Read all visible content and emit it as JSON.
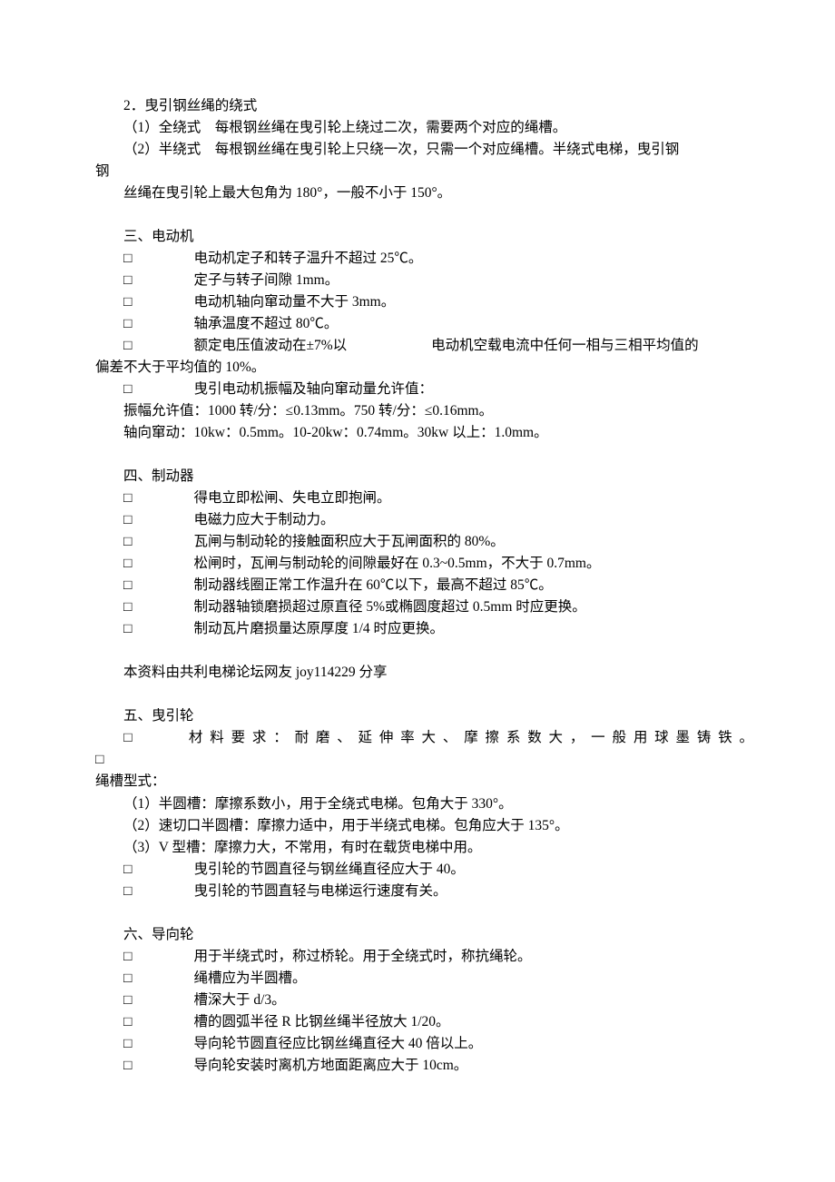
{
  "s2": {
    "title": "2．曳引钢丝绳的绕式",
    "p1": "（1）全绕式　每根钢丝绳在曳引轮上绕过二次，需要两个对应的绳槽。",
    "p2": "（2）半绕式　每根钢丝绳在曳引轮上只绕一次，只需一个对应绳槽。半绕式电梯，曳引钢",
    "p2b": "丝绳在曳引轮上最大包角为 180°，一般不小于 150°。"
  },
  "s3": {
    "title": "三、电动机",
    "b1": "电动机定子和转子温升不超过 25℃。",
    "b2": "定子与转子间隙 1mm。",
    "b3": "电动机轴向窜动量不大于 3mm。",
    "b4": "轴承温度不超过 80℃。",
    "b5a": "额定电压值波动在±7%以",
    "b5b": "电动机空载电流中任何一相与三相平均值的",
    "b5c": "偏差不大于平均值的 10%。",
    "b6": "曳引电动机振幅及轴向窜动量允许值：",
    "l1": "振幅允许值：1000 转/分：≤0.13mm。750 转/分：≤0.16mm。",
    "l2": "轴向窜动：10kw：0.5mm。10-20kw：0.74mm。30kw 以上：1.0mm。"
  },
  "s4": {
    "title": "四、制动器",
    "b1": "得电立即松闸、失电立即抱闸。",
    "b2": "电磁力应大于制动力。",
    "b3": "瓦闸与制动轮的接触面积应大于瓦闸面积的 80%。",
    "b4": "松闸时，瓦闸与制动轮的间隙最好在 0.3~0.5mm，不大于 0.7mm。",
    "b5": "制动器线圈正常工作温升在 60℃以下，最高不超过 85℃。",
    "b6": "制动器轴锁磨损超过原直径 5%或椭圆度超过 0.5mm 时应更换。",
    "b7": "制动瓦片磨损量达原厚度 1/4 时应更换。"
  },
  "note": "本资料由共利电梯论坛网友 joy114229 分享",
  "s5": {
    "title": "五、曳引轮",
    "b1a": "材料要求：耐磨、延伸率大、摩擦系数大，一般用球墨铸铁。",
    "b1b": "绳槽型式：",
    "p1": "（1）半圆槽：摩擦系数小，用于全绕式电梯。包角大于 330°。",
    "p2": "（2）速切口半圆槽：摩擦力适中，用于半绕式电梯。包角应大于 135°。",
    "p3": "（3）V 型槽：摩擦力大，不常用，有时在载货电梯中用。",
    "b2": "曳引轮的节圆直径与钢丝绳直径应大于 40。",
    "b3": "曳引轮的节圆直轻与电梯运行速度有关。"
  },
  "s6": {
    "title": "六、导向轮",
    "b1": "用于半绕式时，称过桥轮。用于全绕式时，称抗绳轮。",
    "b2": "绳槽应为半圆槽。",
    "b3": "槽深大于 d/3。",
    "b4": "槽的圆弧半径 R 比钢丝绳半径放大 1/20。",
    "b5": "导向轮节圆直径应比钢丝绳直径大 40 倍以上。",
    "b6": "导向轮安装时离机方地面距离应大于 10cm。"
  }
}
